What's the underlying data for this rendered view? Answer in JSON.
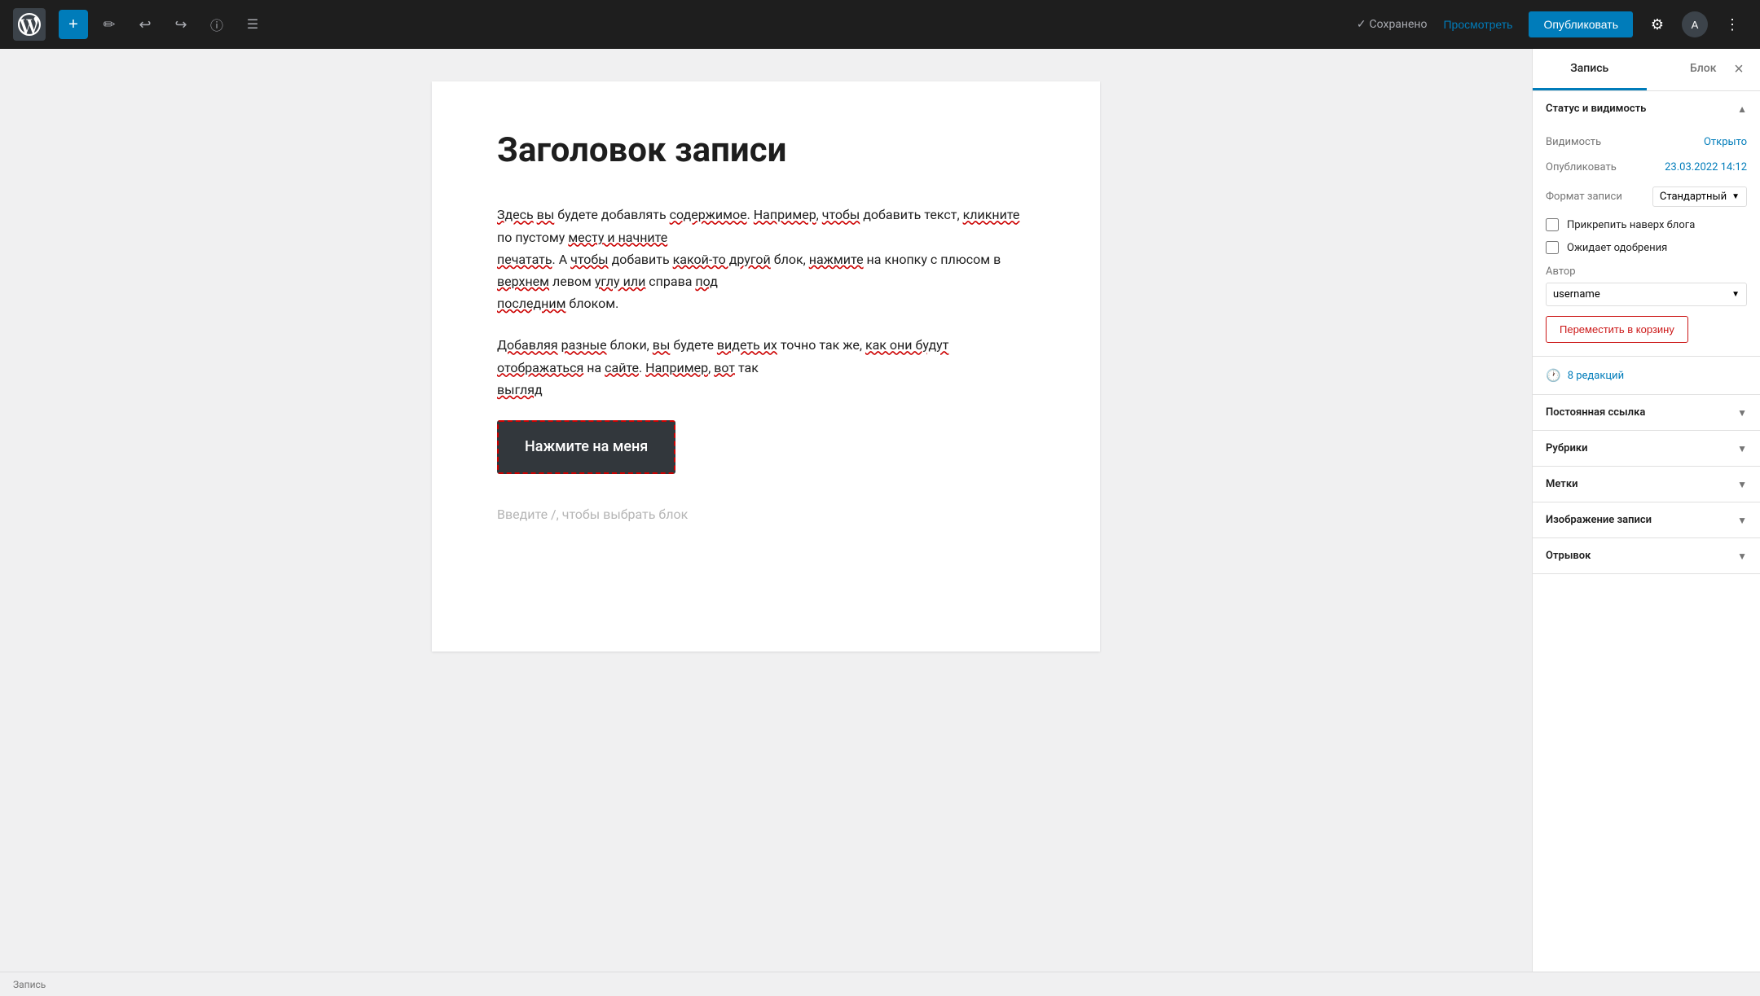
{
  "toolbar": {
    "add_label": "+",
    "undo_label": "↩",
    "redo_label": "↪",
    "info_label": "ⓘ",
    "list_label": "☰",
    "saved_label": "Сохранено",
    "preview_label": "Просмотреть",
    "publish_label": "Опубликовать",
    "settings_icon": "⚙",
    "user_icon": "A",
    "more_icon": "⋮"
  },
  "editor": {
    "post_title": "Заголовок записи",
    "paragraph1": "Здесь вы будете добавлять содержимое. Например, чтобы добавить текст, кликните по пустому месту и начните печатать. А чтобы добавить какой-то другой блок, нажмите на кнопку с плюсом в верхнем левом углу или справа под последним блоком.",
    "paragraph2": "Добавляя разные блоки, вы будете видеть их точно так же, как они будут отображаться на сайте. Например, вот так выгляд",
    "button_text": "Нажмите на меня",
    "placeholder_text": "Введите /, чтобы выбрать блок"
  },
  "status_bar": {
    "label": "Запись"
  },
  "sidebar": {
    "tab_record": "Запись",
    "tab_block": "Блок",
    "section_status": "Статус и видимость",
    "visibility_label": "Видимость",
    "visibility_value": "Открыто",
    "publish_label": "Опубликовать",
    "publish_value": "23.03.2022 14:12",
    "format_label": "Формат записи",
    "format_value": "Стандартный",
    "pin_label": "Прикрепить наверх блога",
    "pending_label": "Ожидает одобрения",
    "author_label": "Автор",
    "author_value": "username",
    "trash_label": "Переместить в корзину",
    "revisions_label": "8 редакций",
    "permalink_label": "Постоянная ссылка",
    "categories_label": "Рубрики",
    "tags_label": "Метки",
    "featured_image_label": "Изображение записи",
    "excerpt_label": "Отрывок"
  }
}
